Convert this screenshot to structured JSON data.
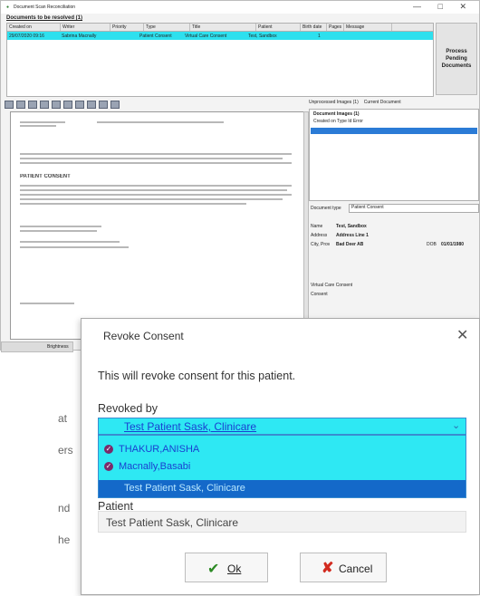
{
  "app": {
    "title": "Document Scan Reconciliation",
    "window_controls": "— □ ✕",
    "docs_header": "Documents to be resolved (1)",
    "columns": [
      "Created on",
      "Writer",
      "Priority",
      "Type",
      "Title",
      "Patient",
      "Birth date",
      "Pages",
      "Message"
    ],
    "row": [
      "29/07/2020 09:16",
      "Sabrina Macnally",
      "",
      "Patient Consent",
      "Virtual Care Consent",
      "Test, Sandbox",
      "",
      "1",
      ""
    ],
    "process_button": "Process Pending Documents",
    "right_tabs": [
      "Unprocessed Images (1)",
      "Current Document"
    ],
    "right_list_header": "Document Images (1)",
    "right_list_row": "Created on   Type   Id  Error",
    "doc_type_label": "Document type",
    "doc_type_value": "Patient Consent",
    "name_label": "Name",
    "name_value": "Test, Sandbox",
    "address_label": "Address",
    "address_value": "Address Line 1",
    "city_label": "City, Prov",
    "city_value": "Bad Deer AB",
    "dob_label": "DOB",
    "dob_value": "01/01/1980",
    "virtual_care": "Virtual Care Consent",
    "consent_label": "Consent",
    "viewer_heading": "PATIENT CONSENT",
    "left_panel_label": "Brightness",
    "bg_text": [
      "at",
      "ers",
      "nd",
      "he"
    ]
  },
  "dialog": {
    "title": "Revoke Consent",
    "close_icon": "close-icon",
    "message": "This will revoke consent for this patient.",
    "revoked_by_label": "Revoked by",
    "revoked_by_value": "Test Patient Sask, Clinicare",
    "options": [
      "THAKUR,ANISHA",
      "Macnally,Basabi",
      "Test Patient Sask, Clinicare"
    ],
    "patient_label": "Patient",
    "patient_value": "Test Patient Sask, Clinicare",
    "ok_label": "Ok",
    "cancel_label": "Cancel",
    "colors": {
      "select_bg": "#2ee8f3",
      "selected_option": "#1469c9",
      "ok_icon": "#2c8a24",
      "cancel_icon": "#d22b20"
    }
  }
}
